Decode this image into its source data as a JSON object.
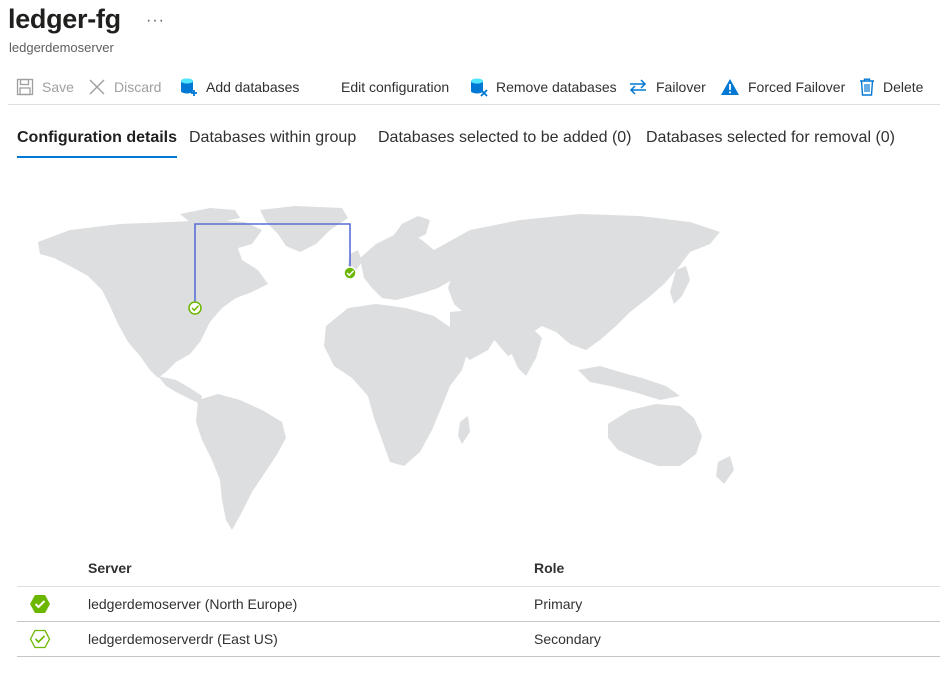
{
  "header": {
    "title": "ledger-fg",
    "more": "···",
    "subtitle": "ledgerdemoserver"
  },
  "toolbar": {
    "save": "Save",
    "discard": "Discard",
    "add_databases": "Add databases",
    "edit_configuration": "Edit configuration",
    "remove_databases": "Remove databases",
    "failover": "Failover",
    "forced_failover": "Forced Failover",
    "delete": "Delete"
  },
  "tabs": [
    {
      "label": "Configuration details",
      "active": true
    },
    {
      "label": "Databases within group",
      "active": false
    },
    {
      "label": "Databases selected to be added (0)",
      "active": false
    },
    {
      "label": "Databases selected for removal (0)",
      "active": false
    }
  ],
  "map": {
    "primary_location": "North Europe",
    "secondary_location": "East US",
    "link_color": "#5a6fd6",
    "land_color": "#dddedf"
  },
  "grid": {
    "columns": [
      "Server",
      "Role"
    ],
    "rows": [
      {
        "server": "ledgerdemoserver (North Europe)",
        "role": "Primary",
        "status_icon": "filled-check-hexagon-icon"
      },
      {
        "server": "ledgerdemoserverdr (East US)",
        "role": "Secondary",
        "status_icon": "outline-check-hexagon-icon"
      }
    ]
  },
  "colors": {
    "accent": "#0078d4",
    "success": "#6bb700",
    "warning_icon": "#0078d4"
  }
}
